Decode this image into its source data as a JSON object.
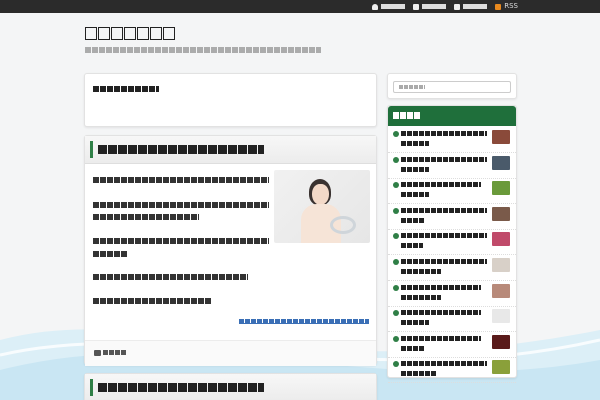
{
  "topnav": {
    "items": [
      {
        "label": "",
        "icon": "user-icon"
      },
      {
        "label": "",
        "icon": "page-icon"
      },
      {
        "label": "",
        "icon": "page-icon"
      },
      {
        "label": "RSS",
        "icon": "rss-icon"
      }
    ]
  },
  "site": {
    "title": "",
    "tagline": ""
  },
  "intro": {
    "text": ""
  },
  "posts": [
    {
      "title": "",
      "paragraphs": [
        "",
        "",
        "",
        "",
        ""
      ],
      "readmore": "",
      "category": ""
    },
    {
      "title": ""
    }
  ],
  "sidebar": {
    "search_placeholder": "",
    "heading": "",
    "items": [
      {
        "title": "",
        "thumb_color": "#8a4a3a"
      },
      {
        "title": "",
        "thumb_color": "#4a5a6a"
      },
      {
        "title": "",
        "thumb_color": "#6a9a3a"
      },
      {
        "title": "",
        "thumb_color": "#7a5a4a"
      },
      {
        "title": "",
        "thumb_color": "#c04a6a"
      },
      {
        "title": "",
        "thumb_color": "#d8d0c8"
      },
      {
        "title": "",
        "thumb_color": "#b88a7a"
      },
      {
        "title": "",
        "thumb_color": "#e8e8e8"
      },
      {
        "title": "",
        "thumb_color": "#5a1a1a"
      },
      {
        "title": "",
        "thumb_color": "#8aa03a"
      }
    ]
  },
  "colors": {
    "accent": "#1f6f3b",
    "link": "#3a6fb6",
    "topbar": "#2b2b2b",
    "rss": "#e8891e"
  }
}
